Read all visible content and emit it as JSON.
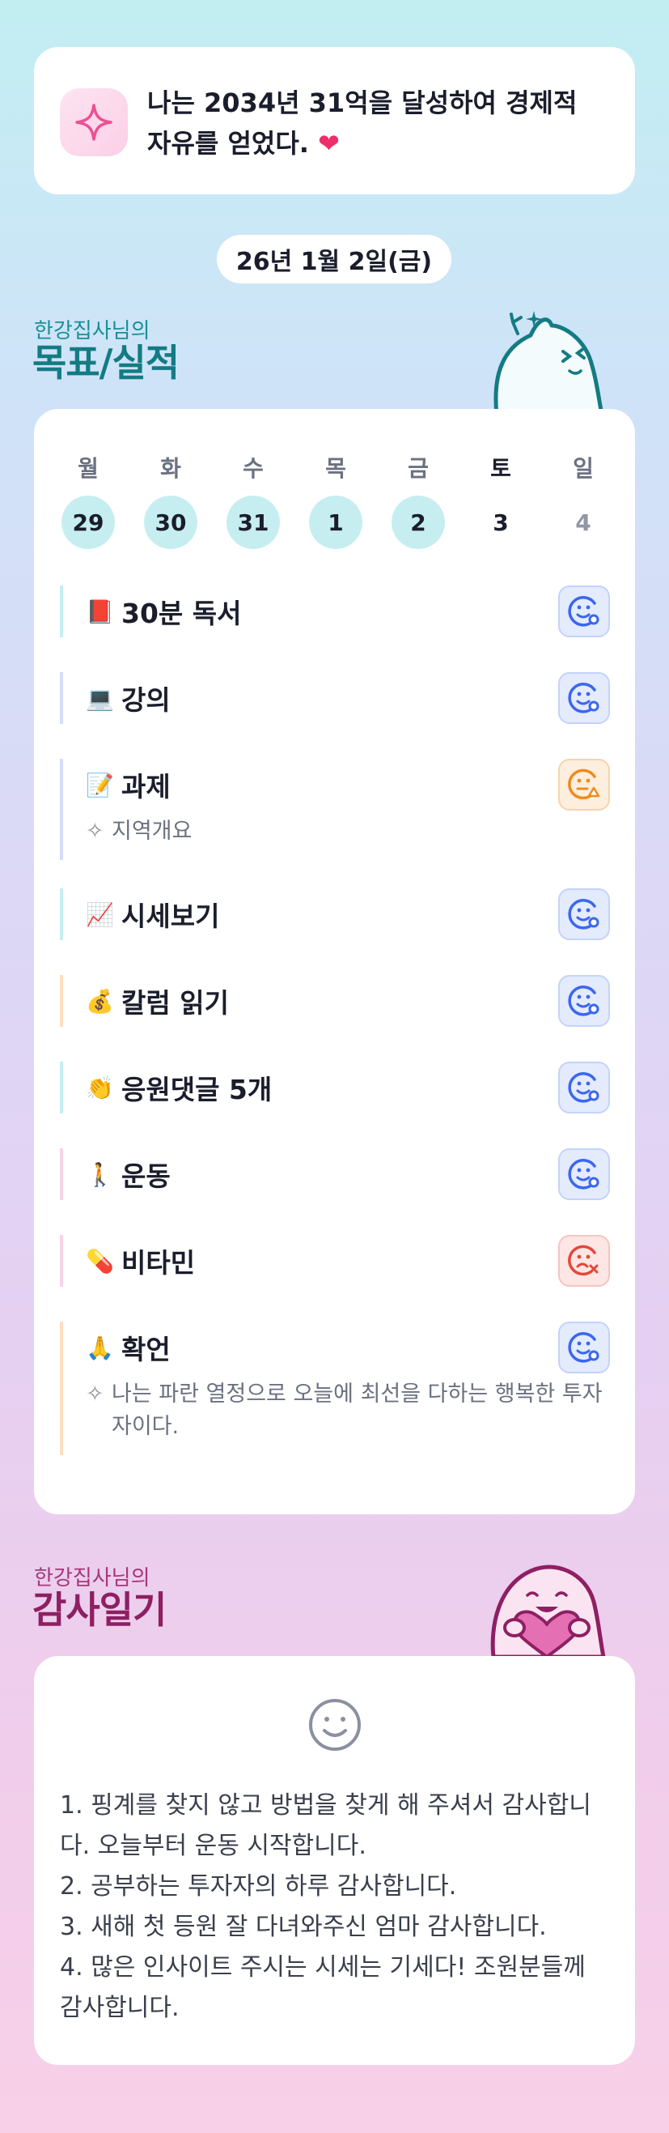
{
  "goal": {
    "text": "나는 2034년 31억을 달성하여 경제적 자유를 얻었다.",
    "heart": "❤",
    "icon": "sparkle-icon"
  },
  "date_label": "26년 1월 2일(금)",
  "goals_section": {
    "subtitle": "한강집사님의",
    "title": "목표/실적"
  },
  "calendar": {
    "weekdays": [
      "월",
      "화",
      "수",
      "목",
      "금",
      "토",
      "일"
    ],
    "days": [
      "29",
      "30",
      "31",
      "1",
      "2",
      "3",
      "4"
    ]
  },
  "tasks": [
    {
      "emoji": "📕",
      "label": "30분 독서",
      "status": "smile-blue",
      "accent": "#c6eef1"
    },
    {
      "emoji": "💻",
      "label": "강의",
      "status": "smile-blue",
      "accent": "#d7dcf8"
    },
    {
      "emoji": "📝",
      "label": "과제",
      "status": "neutral-orange",
      "accent": "#d7dcf8",
      "note": "지역개요"
    },
    {
      "emoji": "📈",
      "label": "시세보기",
      "status": "smile-blue",
      "accent": "#c6eef1"
    },
    {
      "emoji": "💰",
      "label": "칼럼 읽기",
      "status": "smile-blue",
      "accent": "#fde0c0"
    },
    {
      "emoji": "👏",
      "label": "응원댓글 5개",
      "status": "smile-blue",
      "accent": "#c6eef1"
    },
    {
      "emoji": "🚶",
      "label": "운동",
      "status": "smile-blue",
      "accent": "#f8d3e8"
    },
    {
      "emoji": "💊",
      "label": "비타민",
      "status": "sad-red",
      "accent": "#f8d3e8"
    },
    {
      "emoji": "🙏",
      "label": "확언",
      "status": "smile-blue",
      "accent": "#fde0c0",
      "note": "나는 파란 열정으로 오늘에 최선을 다하는 행복한 투자자이다."
    }
  ],
  "gratitude_section": {
    "subtitle": "한강집사님의",
    "title": "감사일기"
  },
  "gratitude": {
    "lines": [
      "1. 핑계를 찾지 않고 방법을 찾게 해 주셔서 감사합니다. 오늘부터 운동 시작합니다.",
      "2. 공부하는 투자자의 하루 감사합니다.",
      "3. 새해 첫 등원 잘 다녀와주신 엄마 감사합니다.",
      "4. 많은 인사이트 주시는 시세는 기세다! 조원분들께 감사합니다."
    ]
  },
  "colors": {
    "teal": "#147b83",
    "magenta": "#8e1f62",
    "status_blue": "#3b66f0",
    "status_orange": "#f08a1c",
    "status_red": "#e4473a"
  }
}
